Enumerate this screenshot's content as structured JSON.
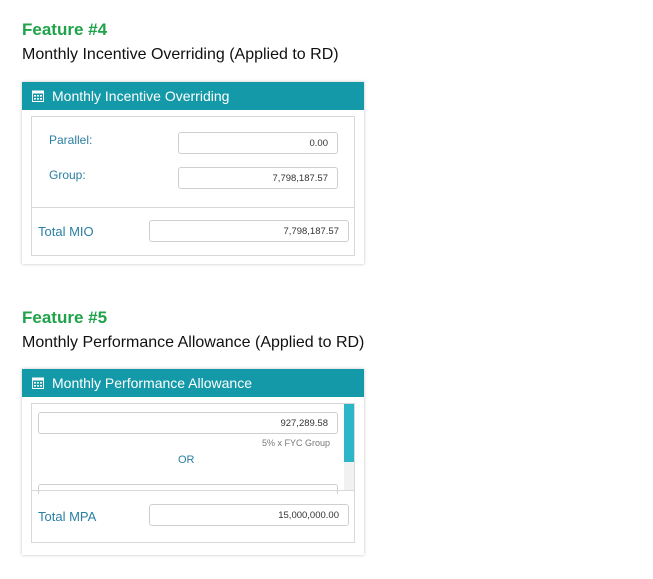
{
  "feature4": {
    "heading": "Feature #4",
    "description": "Monthly Incentive Overriding (Applied to RD)",
    "panel": {
      "title": "Monthly Incentive Overriding",
      "parallel_label": "Parallel:",
      "parallel_value": "0.00",
      "group_label": "Group:",
      "group_value": "7,798,187.57",
      "total_label": "Total MIO",
      "total_value": "7,798,187.57"
    }
  },
  "feature5": {
    "heading": "Feature #5",
    "description": "Monthly Performance Allowance (Applied to RD)",
    "panel": {
      "title": "Monthly Performance Allowance",
      "first_value": "927,289.58",
      "first_hint": "5% x FYC Group",
      "or_text": "OR",
      "total_label": "Total MPA",
      "total_value": "15,000,000.00"
    }
  },
  "colors": {
    "heading_green": "#1fa34a",
    "header_teal": "#1499a8",
    "label_blue": "#2a7fa3",
    "scroll_thumb": "#2cb6c7"
  },
  "icons": {
    "panel_header_icon": "calendar-icon"
  }
}
